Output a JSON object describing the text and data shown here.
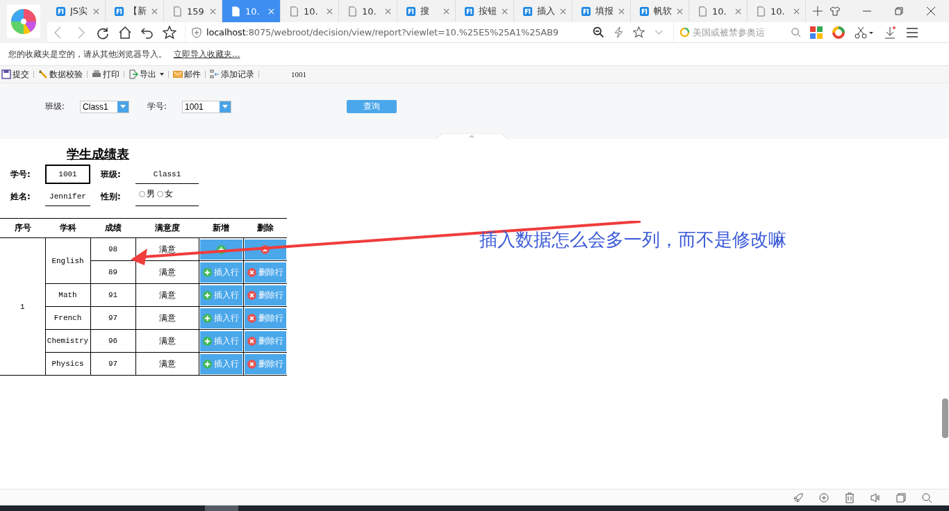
{
  "browser": {
    "tabs": [
      {
        "kind": "app",
        "label": "JS实",
        "selected": false
      },
      {
        "kind": "app",
        "label": "【新",
        "selected": false
      },
      {
        "kind": "page",
        "label": "159",
        "selected": false
      },
      {
        "kind": "page",
        "label": "10.",
        "selected": true
      },
      {
        "kind": "page",
        "label": "10.",
        "selected": false
      },
      {
        "kind": "page",
        "label": "10.",
        "selected": false
      },
      {
        "kind": "app",
        "label": "搜",
        "selected": false
      },
      {
        "kind": "app",
        "label": "按钮",
        "selected": false
      },
      {
        "kind": "app",
        "label": "插入",
        "selected": false
      },
      {
        "kind": "app",
        "label": "填报",
        "selected": false
      },
      {
        "kind": "app",
        "label": "帆软",
        "selected": false
      },
      {
        "kind": "page",
        "label": "10.",
        "selected": false
      },
      {
        "kind": "page",
        "label": "10.",
        "selected": false
      }
    ],
    "url_host": "localhost",
    "url_rest": ":8075/webroot/decision/view/report?viewlet=10.%25E5%25A1%25AB9",
    "search_placeholder": "美国或被禁参奥运"
  },
  "bookmarks_bar": {
    "message": "您的收藏夹是空的，请从其他浏览器导入。",
    "link": "立即导入收藏夹..."
  },
  "toolbar": {
    "buttons": [
      {
        "kind": "submit",
        "label": "提交"
      },
      {
        "kind": "verify",
        "label": "数据校验"
      },
      {
        "kind": "print",
        "label": "打印"
      },
      {
        "kind": "export",
        "label": "导出"
      },
      {
        "kind": "mail",
        "label": "邮件"
      },
      {
        "kind": "add",
        "label": "添加记录"
      }
    ],
    "text": "1001"
  },
  "params": {
    "fields": [
      {
        "label": "班级:",
        "value": "Class1"
      },
      {
        "label": "学号:",
        "value": "1001"
      }
    ],
    "query_button": "查询"
  },
  "report": {
    "title": "学生成绩表",
    "student_id_label": "学号:",
    "student_id": "1001",
    "class_label": "班级:",
    "class": "Class1",
    "name_label": "姓名:",
    "name": "Jennifer",
    "gender_label": "性别:",
    "gender_options": [
      {
        "label": "男",
        "selected": false
      },
      {
        "label": "女",
        "selected": false
      }
    ],
    "columns": [
      "序号",
      "学科",
      "成绩",
      "满意度",
      "新增",
      "删除"
    ],
    "index": "1",
    "subjects": [
      {
        "name": "English",
        "scores": [
          {
            "score": "98",
            "satisfaction": "满意"
          },
          {
            "score": "89",
            "satisfaction": "满意",
            "insert": "插入行",
            "delete": "删除行"
          }
        ]
      },
      {
        "name": "Math",
        "scores": [
          {
            "score": "91",
            "satisfaction": "满意",
            "insert": "插入行",
            "delete": "删除行"
          }
        ]
      },
      {
        "name": "French",
        "scores": [
          {
            "score": "97",
            "satisfaction": "满意",
            "insert": "插入行",
            "delete": "删除行"
          }
        ]
      },
      {
        "name": "Chemistry",
        "scores": [
          {
            "score": "96",
            "satisfaction": "满意",
            "insert": "插入行",
            "delete": "删除行"
          }
        ]
      },
      {
        "name": "Physics",
        "scores": [
          {
            "score": "97",
            "satisfaction": "满意",
            "insert": "插入行",
            "delete": "删除行"
          }
        ]
      }
    ]
  },
  "annotation": "插入数据怎么会多一列，而不是修改嘛"
}
